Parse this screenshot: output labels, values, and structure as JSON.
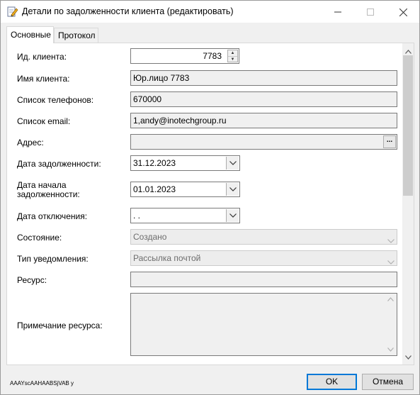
{
  "window": {
    "title": "Детали по задолженности клиента (редактировать)",
    "minimize_icon": "minimize-icon",
    "maximize_icon": "maximize-icon",
    "close_icon": "close-icon"
  },
  "tabs": [
    {
      "label": "Основные",
      "active": true
    },
    {
      "label": "Протокол",
      "active": false
    }
  ],
  "form": {
    "client_id": {
      "label": "Ид. клиента:",
      "value": "7783"
    },
    "client_name": {
      "label": "Имя клиента:",
      "value": "Юр.лицо 7783"
    },
    "phones": {
      "label": "Список телефонов:",
      "value": "670000"
    },
    "emails": {
      "label": "Список email:",
      "value": "1,andy@inotechgroup.ru"
    },
    "address": {
      "label": "Адрес:",
      "value": "",
      "button": "..."
    },
    "debt_date": {
      "label": "Дата задолженности:",
      "value": "31.12.2023"
    },
    "debt_start_date": {
      "label_line1": "Дата начала",
      "label_line2": "задолженности:",
      "value": "01.01.2023"
    },
    "disconnect_date": {
      "label": "Дата отключения:",
      "value": " .  ."
    },
    "state": {
      "label": "Состояние:",
      "value": "Создано"
    },
    "notify_type": {
      "label": "Тип уведомления:",
      "value": "Рассылка почтой"
    },
    "resource": {
      "label": "Ресурс:",
      "value": ""
    },
    "resource_note": {
      "label": "Примечание ресурса:",
      "value": ""
    }
  },
  "footer": {
    "record_id": "AAAYscAAHAABSjVAB y",
    "ok_label": "OK",
    "cancel_label": "Отмена"
  }
}
